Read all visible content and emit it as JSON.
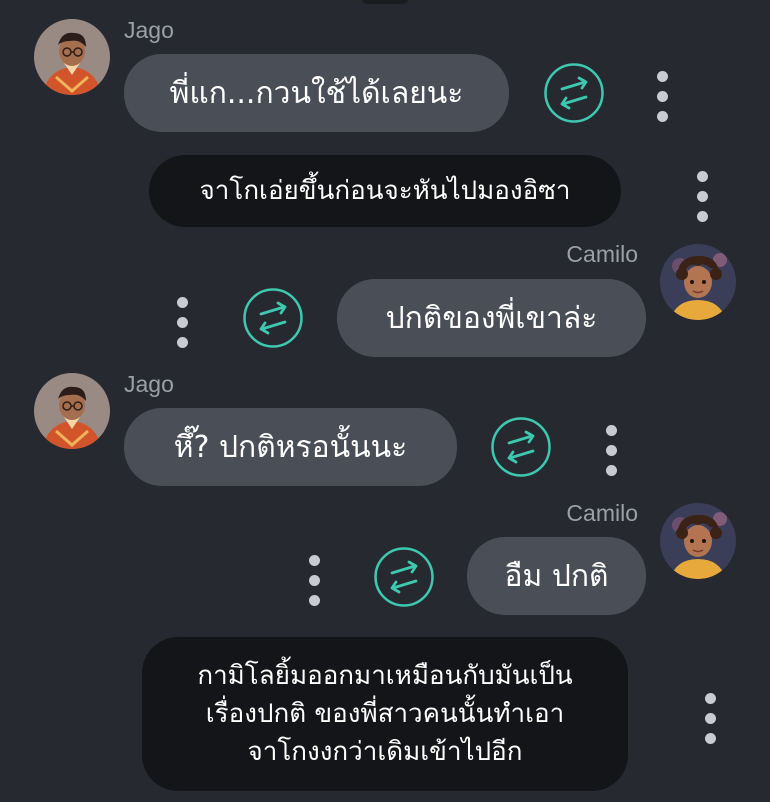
{
  "characters": {
    "jago": "Jago",
    "camilo": "Camilo"
  },
  "messages": [
    {
      "speaker": "Jago",
      "text": "พี่แก...กวนใช้ได้เลยนะ"
    },
    {
      "narration": "จาโกเอ่ยขึ้นก่อนจะหันไปมองอิซา"
    },
    {
      "speaker": "Camilo",
      "text": "ปกติของพี่เขาล่ะ"
    },
    {
      "speaker": "Jago",
      "text": "หึ๊? ปกติหรอนั้นนะ"
    },
    {
      "speaker": "Camilo",
      "text": "อืม ปกติ"
    },
    {
      "narration_lines": [
        "กามิโลยิ้มออกมาเหมือนกับมันเป็น",
        "เรื่องปกติ ของพี่สาวคนนั้นทำเอา",
        "จาโกงงกว่าเดิมเข้าไปอีก"
      ]
    }
  ],
  "icons": {
    "swap": "swap-arrows-icon",
    "menu": "more-vertical-icon"
  },
  "colors": {
    "background": "#262930",
    "bubble": "#4a4e57",
    "narration": "#141518",
    "accent": "#3ec8b0"
  }
}
